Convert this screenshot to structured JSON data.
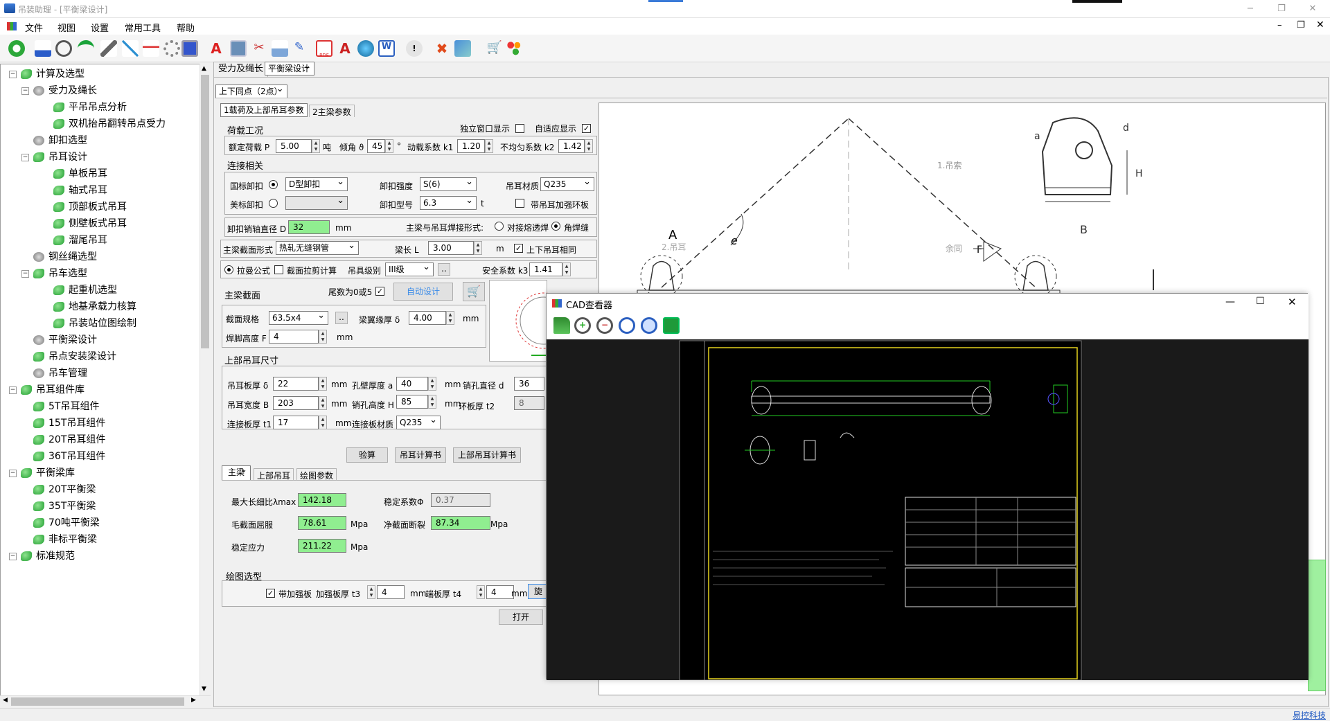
{
  "window": {
    "title": "吊装助理 - [平衡梁设计]"
  },
  "menu": [
    "文件",
    "视图",
    "设置",
    "常用工具",
    "帮助"
  ],
  "tree": {
    "items": [
      {
        "label": "计算及选型",
        "level": 0,
        "exp": "−"
      },
      {
        "label": "受力及绳长",
        "level": 1,
        "exp": "−"
      },
      {
        "label": "平吊吊点分析",
        "level": 2
      },
      {
        "label": "双机抬吊翻转吊点受力",
        "level": 2
      },
      {
        "label": "卸扣选型",
        "level": 1
      },
      {
        "label": "吊耳设计",
        "level": 1,
        "exp": "−"
      },
      {
        "label": "单板吊耳",
        "level": 2
      },
      {
        "label": "轴式吊耳",
        "level": 2
      },
      {
        "label": "顶部板式吊耳",
        "level": 2
      },
      {
        "label": "侧壁板式吊耳",
        "level": 2
      },
      {
        "label": "溜尾吊耳",
        "level": 2
      },
      {
        "label": "钢丝绳选型",
        "level": 1
      },
      {
        "label": "吊车选型",
        "level": 1,
        "exp": "−"
      },
      {
        "label": "起重机选型",
        "level": 2
      },
      {
        "label": "地基承载力核算",
        "level": 2
      },
      {
        "label": "吊装站位图绘制",
        "level": 2
      },
      {
        "label": "平衡梁设计",
        "level": 1
      },
      {
        "label": "吊点安装梁设计",
        "level": 1
      },
      {
        "label": "吊车管理",
        "level": 1
      },
      {
        "label": "吊耳组件库",
        "level": 0,
        "exp": "−"
      },
      {
        "label": "5T吊耳组件",
        "level": 1
      },
      {
        "label": "15T吊耳组件",
        "level": 1
      },
      {
        "label": "20T吊耳组件",
        "level": 1
      },
      {
        "label": "36T吊耳组件",
        "level": 1
      },
      {
        "label": "平衡梁库",
        "level": 0,
        "exp": "−"
      },
      {
        "label": "20T平衡梁",
        "level": 1
      },
      {
        "label": "35T平衡梁",
        "level": 1
      },
      {
        "label": "70吨平衡梁",
        "level": 1
      },
      {
        "label": "非标平衡梁",
        "level": 1
      },
      {
        "label": "标准规范",
        "level": 0,
        "exp": "−"
      }
    ]
  },
  "doc_tabs": [
    "受力及绳长",
    "平衡梁设计"
  ],
  "sub_tab": "上下同点（2点）",
  "param_tabs": [
    "1载荷及上部吊耳参数",
    "2主梁参数"
  ],
  "load": {
    "section": "荷载工况",
    "independent": "独立窗口显示",
    "adaptive": "自适应显示",
    "rated_label": "额定荷载 P",
    "rated": "5.00",
    "rated_unit": "吨",
    "angle_label": "倾角 ϑ",
    "angle": "45",
    "angle_unit": "°",
    "dyn_label": "动载系数 k1",
    "dyn": "1.20",
    "uneven_label": "不均匀系数 k2",
    "uneven": "1.42"
  },
  "conn": {
    "section": "连接相关",
    "gb": "国标卸扣",
    "gb_type": "D型卸扣",
    "us": "美标卸扣",
    "grade_label": "卸扣强度",
    "grade": "S(6)",
    "model_label": "卸扣型号",
    "model": "6.3",
    "model_unit": "t",
    "mat_label": "吊耳材质",
    "mat": "Q235",
    "ring": "带吊耳加强环板",
    "pin_label": "卸扣销轴直径 D",
    "pin": "32",
    "pin_unit": "mm",
    "weld_label": "主梁与吊耳焊接形式:",
    "weld1": "对接熔透焊",
    "weld2": "角焊缝"
  },
  "beam": {
    "form_label": "主梁截面形式",
    "form": "热轧无缝钢管",
    "len_label": "梁长 L",
    "len": "3.00",
    "len_unit": "m",
    "same": "上下吊耳相同"
  },
  "calc": {
    "lame": "拉曼公式",
    "shear": "截面拉剪计算",
    "class_label": "吊具级别",
    "class": "III级",
    "sf_label": "安全系数 k3",
    "sf": "1.41"
  },
  "main": {
    "section": "主梁截面",
    "tail": "尾数为0或5",
    "auto": "自动设计",
    "spec_label": "截面规格",
    "spec": "63.5x4",
    "wing_label": "梁翼缘厚 δ",
    "wing": "4.00",
    "wing_unit": "mm",
    "weld_label": "焊脚高度 F",
    "weld": "4",
    "weld_unit": "mm"
  },
  "upper": {
    "section": "上部吊耳尺寸",
    "t_label": "吊耳板厚 δ",
    "t": "22",
    "hole_label": "孔壁厚度 a",
    "hole": "40",
    "d_label": "销孔直径 d",
    "d": "36",
    "b_label": "吊耳宽度 B",
    "b": "203",
    "h_label": "销孔高度 H",
    "h": "85",
    "t2_label": "环板厚 t2",
    "t2": "8",
    "t1_label": "连接板厚 t1",
    "t1": "17",
    "cmat_label": "连接板材质",
    "cmat": "Q235",
    "mm": "mm"
  },
  "buttons": {
    "check": "验算",
    "lug_book": "吊耳计算书",
    "upper_book": "上部吊耳计算书",
    "open": "打开"
  },
  "result_tabs": [
    "主梁",
    "上部吊耳",
    "绘图参数"
  ],
  "result": {
    "lambda_label": "最大长细比λmax",
    "lambda": "142.18",
    "phi_label": "稳定系数Φ",
    "phi": "0.37",
    "gross_label": "毛截面屈服",
    "gross": "78.61",
    "net_label": "净截面断裂",
    "net": "87.34",
    "stab_label": "稳定应力",
    "stab": "211.22",
    "mpa": "Mpa"
  },
  "drawing": {
    "section": "绘图选型",
    "plate": "带加强板",
    "t3_label": "加强板厚 t3",
    "t3": "4",
    "t4_label": "端板厚 t4",
    "t4": "4",
    "mm": "mm",
    "btn": "旋"
  },
  "cad": {
    "title": "CAD查看器",
    "dim_a": "a",
    "dim_d": "d",
    "dim_h": "H",
    "dim_b": "B",
    "dim_e": "e",
    "lbl_a": "A",
    "lbl_f": "F",
    "rope": "1.吊索",
    "rope2": "余同",
    "lug": "2.吊耳"
  },
  "status": {
    "brand": "易控科技"
  }
}
